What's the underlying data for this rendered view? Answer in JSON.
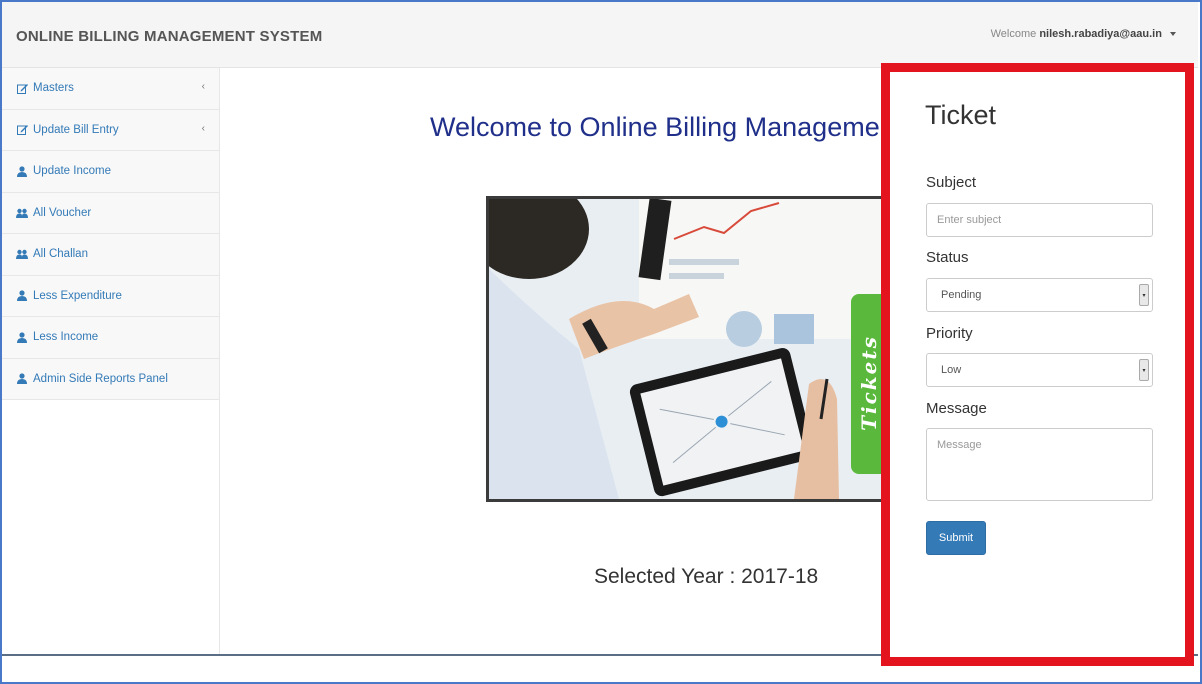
{
  "header": {
    "brand": "ONLINE BILLING MANAGEMENT SYSTEM",
    "welcome_label": "Welcome",
    "user": "nilesh.rabadiya@aau.in"
  },
  "sidebar": {
    "items": [
      {
        "label": "Masters",
        "icon": "edit-icon",
        "has_arrow": true
      },
      {
        "label": "Update Bill Entry",
        "icon": "edit-icon",
        "has_arrow": true
      },
      {
        "label": "Update Income",
        "icon": "user-icon",
        "has_arrow": false
      },
      {
        "label": "All Voucher",
        "icon": "group-icon",
        "has_arrow": false
      },
      {
        "label": "All Challan",
        "icon": "group-icon",
        "has_arrow": false
      },
      {
        "label": "Less Expenditure",
        "icon": "user-icon",
        "has_arrow": false
      },
      {
        "label": "Less Income",
        "icon": "user-icon",
        "has_arrow": false
      },
      {
        "label": "Admin Side Reports Panel",
        "icon": "user-icon",
        "has_arrow": false
      }
    ],
    "arrow_glyph": "‹"
  },
  "main": {
    "title": "Welcome to Online Billing Management",
    "hero_tab": "Tickets",
    "selected_year": "Selected Year : 2017-18"
  },
  "ticket": {
    "title": "Ticket",
    "subject_label": "Subject",
    "subject_placeholder": "Enter subject",
    "status_label": "Status",
    "status_value": "Pending",
    "priority_label": "Priority",
    "priority_value": "Low",
    "message_label": "Message",
    "message_placeholder": "Message",
    "submit_label": "Submit"
  },
  "colors": {
    "accent": "#337ab7",
    "highlight_border": "#e4141e",
    "title_blue": "#1f2f8a",
    "tickets_tab": "#5ab83c"
  }
}
